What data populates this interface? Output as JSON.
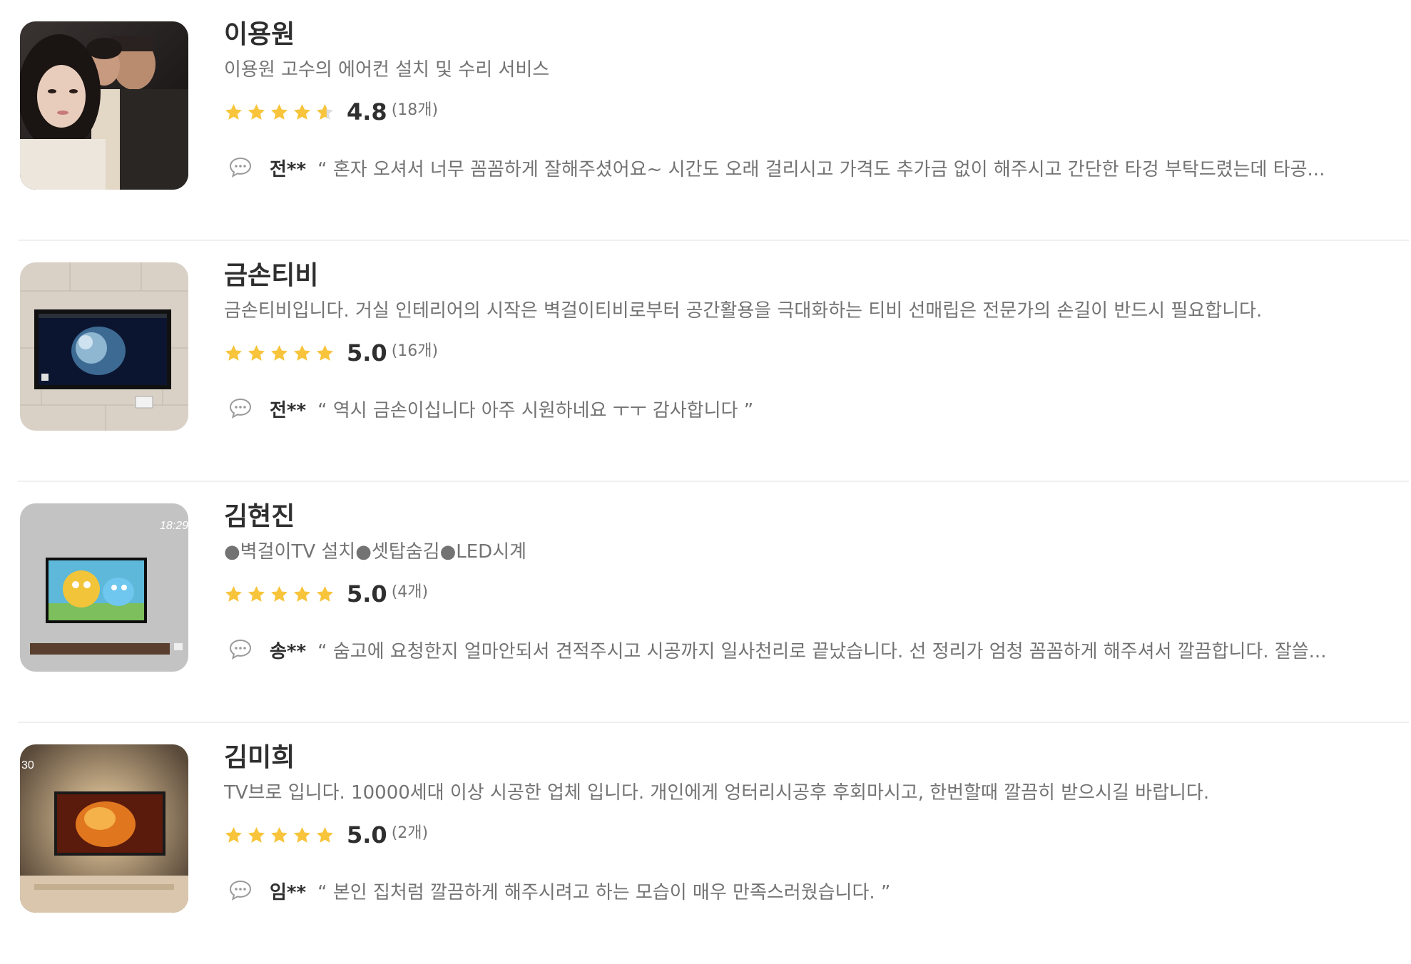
{
  "pros": [
    {
      "name": "이용원",
      "description": "이용원 고수의 에어컨 설치 및 수리 서비스",
      "rating": "4.8",
      "rating_fill": 0.96,
      "review_count": "(18개)",
      "reviewer": "전**",
      "review": "“ 혼자 오셔서 너무 꼼꼼하게 잘해주셨어요~ 시간도 오래 걸리시고 가격도 추가금 없이 해주시고 간단한 타겅 부탁드렸는데 타공..."
    },
    {
      "name": "금손티비",
      "description": "금손티비입니다. 거실 인테리어의 시작은 벽걸이티비로부터 공간활용을 극대화하는 티비 선매립은 전문가의 손길이 반드시 필요합니다.",
      "rating": "5.0",
      "rating_fill": 1.0,
      "review_count": "(16개)",
      "reviewer": "전**",
      "review": "“ 역시 금손이십니다 아주 시원하네요 ㅜㅜ 감사합니다 ”"
    },
    {
      "name": "김현진",
      "description": "●벽걸이TV 설치●셋탑숨김●LED시계",
      "rating": "5.0",
      "rating_fill": 1.0,
      "review_count": "(4개)",
      "reviewer": "송**",
      "review": "“ 숨고에 요청한지 얼마안되서 견적주시고 시공까지 일사천리로 끝났습니다. 선 정리가 엄청 꼼꼼하게 해주셔서 깔끔합니다. 잘쓸..."
    },
    {
      "name": "김미희",
      "description": "TV브로 입니다. 10000세대 이상 시공한 업체 입니다. 개인에게 엉터리시공후 후회마시고, 한번할때 깔끔히 받으시길 바랍니다.",
      "rating": "5.0",
      "rating_fill": 1.0,
      "review_count": "(2개)",
      "reviewer": "임**",
      "review": "“ 본인 집처럼 깔끔하게 해주시려고 하는 모습이 매우 만족스러웠습니다. ”"
    }
  ],
  "colors": {
    "star": "#f7c43b",
    "star_empty": "#dddddd",
    "divider": "#efefef",
    "muted_text": "#737373",
    "name_text": "#2f2f2f"
  },
  "icons": {
    "star": "star-icon",
    "chat": "speech-bubble-icon"
  }
}
